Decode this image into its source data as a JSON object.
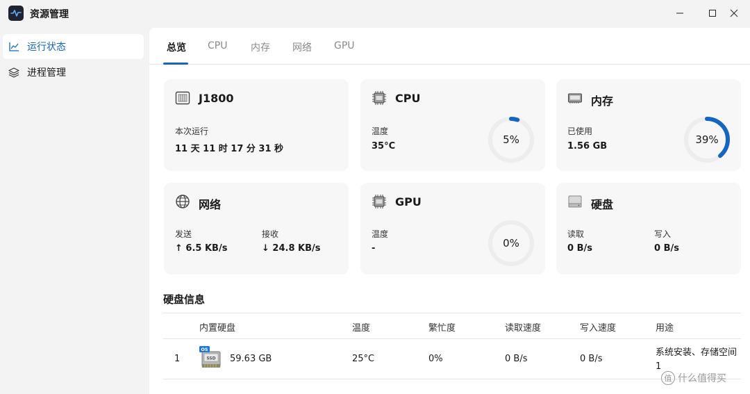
{
  "app": {
    "title": "资源管理",
    "icon": "activity-icon"
  },
  "window_controls": {
    "minimize": "—",
    "maximize": "☐",
    "close": "✕"
  },
  "sidebar": {
    "items": [
      {
        "label": "运行状态",
        "icon": "line-chart-icon",
        "active": true
      },
      {
        "label": "进程管理",
        "icon": "layers-icon",
        "active": false
      }
    ]
  },
  "tabs": [
    {
      "label": "总览",
      "active": true
    },
    {
      "label": "CPU",
      "active": false
    },
    {
      "label": "内存",
      "active": false
    },
    {
      "label": "网络",
      "active": false
    },
    {
      "label": "GPU",
      "active": false
    }
  ],
  "cards": {
    "system": {
      "title": "J1800",
      "icon": "server-icon",
      "uptime_label": "本次运行",
      "uptime_value": "11 天 11 时 17 分 31 秒"
    },
    "cpu": {
      "title": "CPU",
      "icon": "cpu-chip-icon",
      "temp_label": "温度",
      "temp_value": "35°C",
      "usage_text": "5%",
      "usage_fraction": 0.05
    },
    "memory": {
      "title": "内存",
      "icon": "ram-icon",
      "used_label": "已使用",
      "used_value": "1.56 GB",
      "usage_text": "39%",
      "usage_fraction": 0.39
    },
    "network": {
      "title": "网络",
      "icon": "globe-icon",
      "send_label": "发送",
      "send_value": "↑  6.5 KB/s",
      "recv_label": "接收",
      "recv_value": "↓  24.8 KB/s"
    },
    "gpu": {
      "title": "GPU",
      "icon": "gpu-chip-icon",
      "temp_label": "温度",
      "temp_value": "-",
      "usage_text": "0%",
      "usage_fraction": 0.0
    },
    "disk": {
      "title": "硬盘",
      "icon": "disk-drive-icon",
      "read_label": "读取",
      "read_value": "0 B/s",
      "write_label": "写入",
      "write_value": "0 B/s"
    }
  },
  "disk_info": {
    "title": "硬盘信息",
    "columns": [
      "内置硬盘",
      "温度",
      "繁忙度",
      "读取速度",
      "写入速度",
      "用途"
    ],
    "rows": [
      {
        "index": "1",
        "icon": "ssd-icon",
        "badge": "OS",
        "size": "59.63 GB",
        "temp": "25°C",
        "busy": "0%",
        "read": "0 B/s",
        "write": "0 B/s",
        "usage": "系统安装、存储空间 1"
      }
    ]
  },
  "watermark": {
    "icon_text": "值",
    "text": "什么值得买"
  },
  "colors": {
    "accent": "#1566c0",
    "ring_track": "#ededed",
    "card_bg": "#f7f7f7",
    "window_bg": "#f3f3f3"
  }
}
